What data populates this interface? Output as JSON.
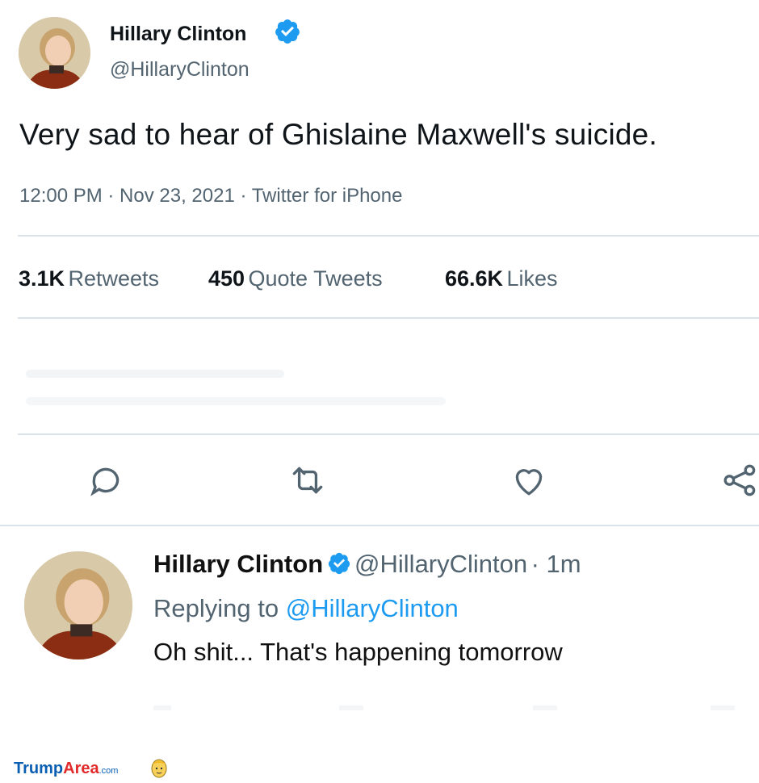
{
  "tweet": {
    "author_name": "Hillary Clinton",
    "author_handle": "@HillaryClinton",
    "text": "Very sad to hear of Ghislaine Maxwell's suicide.",
    "meta": "12:00 PM · Nov 23, 2021 · Twitter for iPhone",
    "stats": {
      "retweets_count": "3.1K",
      "retweets_label": "Retweets",
      "quotes_count": "450",
      "quotes_label": "Quote Tweets",
      "likes_count": "66.6K",
      "likes_label": "Likes"
    },
    "actions": [
      "reply-icon",
      "retweet-icon",
      "like-icon",
      "share-icon"
    ]
  },
  "reply": {
    "author_name": "Hillary Clinton",
    "author_handle": "@HillaryClinton",
    "time": "· 1m",
    "replying_prefix": "Replying to",
    "replying_handle": "@HillaryClinton",
    "text": "Oh shit... That's happening tomorrow"
  },
  "watermark": {
    "part1": "Trump",
    "part2": "Area",
    "part3": ".com"
  },
  "colors": {
    "verified": "#1d9bf0",
    "link": "#1d9bf0",
    "secondary_text": "#536471"
  }
}
